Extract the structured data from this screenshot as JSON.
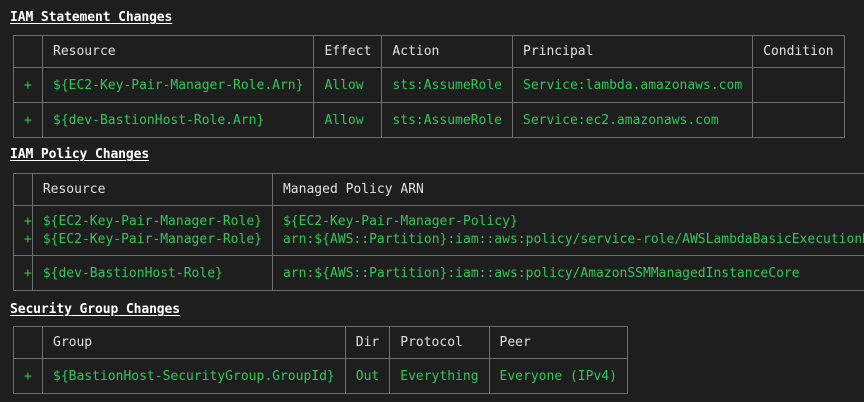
{
  "sections": {
    "iam_statements": {
      "title": "IAM Statement Changes",
      "headers": [
        "",
        "Resource",
        "Effect",
        "Action",
        "Principal",
        "Condition"
      ],
      "rows": [
        {
          "change": "+",
          "resource": "${EC2-Key-Pair-Manager-Role.Arn}",
          "effect": "Allow",
          "action": "sts:AssumeRole",
          "principal": "Service:lambda.amazonaws.com",
          "condition": ""
        },
        {
          "change": "+",
          "resource": "${dev-BastionHost-Role.Arn}",
          "effect": "Allow",
          "action": "sts:AssumeRole",
          "principal": "Service:ec2.amazonaws.com",
          "condition": ""
        }
      ]
    },
    "iam_policies": {
      "title": "IAM Policy Changes",
      "headers": [
        "",
        "Resource",
        "Managed Policy ARN"
      ],
      "rows": [
        {
          "change": [
            "+",
            "+"
          ],
          "resource": [
            "${EC2-Key-Pair-Manager-Role}",
            "${EC2-Key-Pair-Manager-Role}"
          ],
          "arn": [
            "${EC2-Key-Pair-Manager-Policy}",
            "arn:${AWS::Partition}:iam::aws:policy/service-role/AWSLambdaBasicExecutionRole"
          ]
        },
        {
          "change": [
            "+"
          ],
          "resource": [
            "${dev-BastionHost-Role}"
          ],
          "arn": [
            "arn:${AWS::Partition}:iam::aws:policy/AmazonSSMManagedInstanceCore"
          ]
        }
      ]
    },
    "security_groups": {
      "title": "Security Group Changes",
      "headers": [
        "",
        "Group",
        "Dir",
        "Protocol",
        "Peer"
      ],
      "rows": [
        {
          "change": "+",
          "group": "${BastionHost-SecurityGroup.GroupId}",
          "dir": "Out",
          "protocol": "Everything",
          "peer": "Everyone (IPv4)"
        }
      ]
    }
  },
  "colors": {
    "background": "#1e1e1e",
    "added": "#32c75c",
    "border": "#6e6e6e",
    "title": "#ffffff"
  }
}
